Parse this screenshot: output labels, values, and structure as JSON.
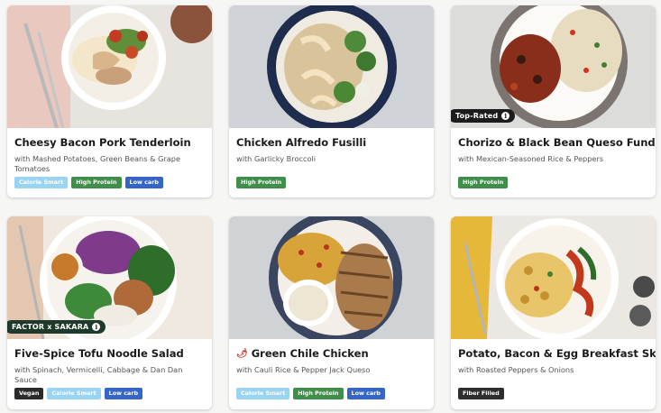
{
  "colors": {
    "calorie_smart": "#9ad4f3",
    "high_protein": "#3f8f4a",
    "low_carb": "#3566c7",
    "vegan": "#2a2a2a",
    "fiber_filled": "#2e2e2e"
  },
  "meals": [
    {
      "title": "Cheesy Bacon Pork Tenderloin",
      "subtitle": "with Mashed Potatoes, Green Beans & Grape Tomatoes",
      "tags": [
        "Calorie Smart",
        "High Protein",
        "Low carb"
      ]
    },
    {
      "title": "Chicken Alfredo Fusilli",
      "subtitle": "with Garlicky Broccoli",
      "tags": [
        "High Protein"
      ]
    },
    {
      "title": "Chorizo & Black Bean Queso Fundido",
      "subtitle": "with Mexican-Seasoned Rice & Peppers",
      "tags": [
        "High Protein"
      ],
      "badge": "Top-Rated"
    },
    {
      "title": "Five-Spice Tofu Noodle Salad",
      "subtitle": "with Spinach, Vermicelli, Cabbage & Dan Dan Sauce",
      "tags": [
        "Vegan",
        "Calorie Smart",
        "Low carb"
      ],
      "badge": "FACTOR x SAKARA"
    },
    {
      "title": "Green Chile Chicken",
      "subtitle": "with Cauli Rice & Pepper Jack Queso",
      "tags": [
        "Calorie Smart",
        "High Protein",
        "Low carb"
      ],
      "icon": "chili-pepper-icon"
    },
    {
      "title": "Potato, Bacon & Egg Breakfast Skillet",
      "subtitle": "with Roasted Peppers & Onions",
      "tags": [
        "Fiber Filled"
      ]
    }
  ]
}
